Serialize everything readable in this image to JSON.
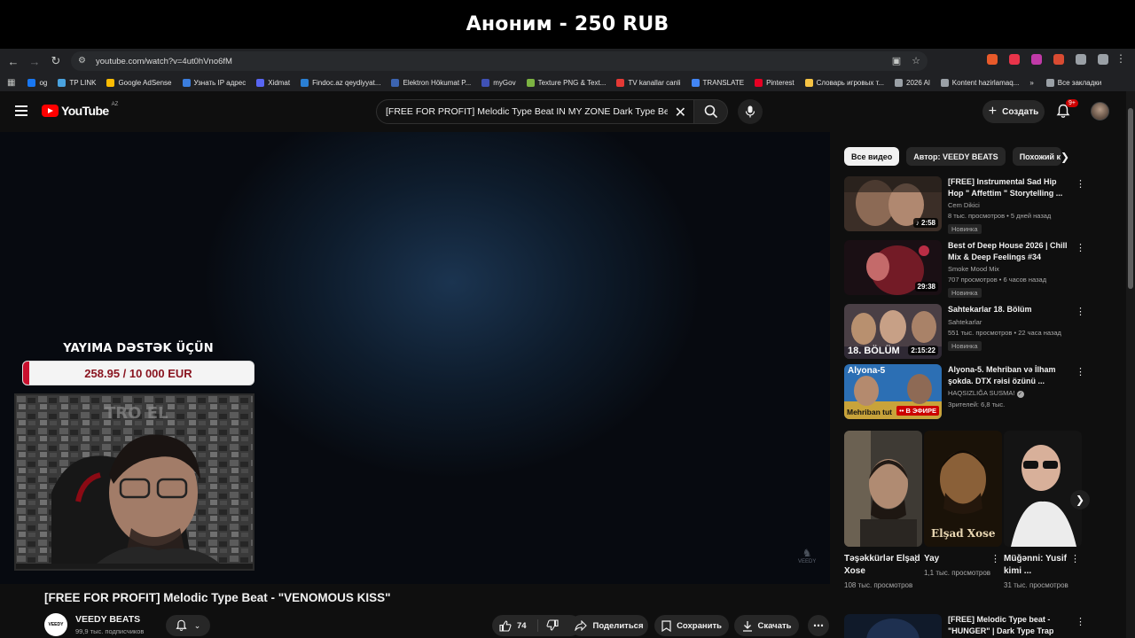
{
  "stream_banner": {
    "text": "Аноним - 250 RUB"
  },
  "browser": {
    "url": "youtube.com/watch?v=4ut0hVno6fM",
    "bookmarks": [
      "og",
      "TP LINK",
      "Google AdSense",
      "Узнать IP адрес",
      "Xidmat",
      "Findoc.az qeydiyyat...",
      "Elektron Hökumat P...",
      "myGov",
      "Texture PNG & Text...",
      "TV kanallar canli",
      "TRANSLATE",
      "Pinterest",
      "Словарь игровых т...",
      "2026 Al",
      "Kontent hazirlamaq...",
      "Все закладки"
    ],
    "extension_colors": [
      "#e85a2a",
      "#e8344a",
      "#c13aa8",
      "#d94b32",
      "#9aa0a6",
      "#9aa0a6"
    ]
  },
  "youtube": {
    "logo_text": "YouTube",
    "region": "AZ",
    "search_query": "[FREE FOR PROFIT] Melodic Type Beat IN MY ZONE Dark Type Beat",
    "search_icon": "search-icon",
    "create_label": "Создать",
    "notif_count": "9+"
  },
  "overlay": {
    "donation_title": "YAYIMA DƏSTƏK ÜÇÜN",
    "donation_amount": "258.95 / 10 000 EUR",
    "donation_progress": 0.026,
    "watermark": "VEEDY"
  },
  "video": {
    "title": "[FREE FOR PROFIT] Melodic Type Beat - \"VENOMOUS KISS\"",
    "channel_name": "VEEDY BEATS",
    "channel_subs": "99,9 тыс. подписчиков",
    "channel_avatar_text": "VEEDY",
    "likes": "74",
    "share_label": "Поделиться",
    "save_label": "Сохранить",
    "download_label": "Скачать"
  },
  "chips": [
    "Все видео",
    "Автор: VEEDY BEATS",
    "Похожий к"
  ],
  "recommendations": [
    {
      "title": "[FREE] Instrumental Sad Hip Hop \" Affettim \" Storytelling ...",
      "channel": "Cem Dikici",
      "meta": "8 тыс. просмотров • 5 дней назад",
      "badge": "Новинка",
      "duration": "2:58"
    },
    {
      "title": "Best of Deep House 2026 | Chill Mix & Deep Feelings #34",
      "channel": "Smoke Mood Mix",
      "meta": "707 просмотров • 6 часов назад",
      "badge": "Новинка",
      "duration": "29:38"
    },
    {
      "title": "Sahtekarlar 18. Bölüm",
      "channel": "Sahtekarlar",
      "meta": "551 тыс. просмотров • 22 часа назад",
      "badge": "Новинка",
      "duration": "2:15:22",
      "thumb_text": "18. BÖLÜM"
    },
    {
      "title": "Alyona-5. Mehriban və İlham şokda. DTX rəisi özünü ...",
      "channel": "HAQSIZLIĞA SUSMA!",
      "meta": "Зрителей: 6,8 тыс.",
      "live_label": "В ЭФИРЕ",
      "thumb_top": "Alyona-5",
      "thumb_bottom": "Mehriban tut"
    },
    {
      "title": "[FREE] Melodic Type beat - \"HUNGER\" | Dark Type Trap Be..."
    }
  ],
  "shorts": [
    {
      "title": "Təşəkkürlər Elşad Xose",
      "views": "108 тыс. просмотров"
    },
    {
      "title": "Yay",
      "views": "1,1 тыс. просмотров",
      "thumb_text": "Elşad Xose"
    },
    {
      "title": "Müğənni: Yusif kimi ...",
      "views": "31 тыс. просмотров"
    }
  ]
}
